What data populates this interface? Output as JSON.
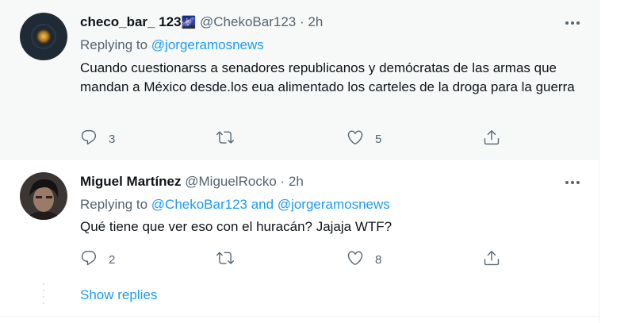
{
  "tweets": [
    {
      "name": "checo_bar_ 123",
      "name_emoji": "🌌",
      "handle": "@ChekoBar123",
      "dot": "·",
      "time": "2h",
      "replying_prefix": "Replying to ",
      "replying_to": "@jorgeramosnews",
      "text": "Cuando cuestionarss a senadores republicanos y demócratas de las armas que mandan a México desde.los eua alimentado los carteles de la droga para la guerra",
      "replies": "3",
      "retweets": "",
      "likes": "5"
    },
    {
      "name": "Miguel Martínez",
      "handle": "@MiguelRocko",
      "dot": "·",
      "time": "2h",
      "replying_prefix": "Replying to ",
      "replying_to_1": "@ChekoBar123",
      "replying_join": " and ",
      "replying_to_2": "@jorgeramosnews",
      "text": "Qué tiene que ver eso con el huracán? Jajaja WTF?",
      "replies": "2",
      "retweets": "",
      "likes": "8"
    }
  ],
  "show_replies": "Show replies",
  "colors": {
    "accent": "#1d9bf0",
    "muted": "#536471",
    "text": "#0f1419",
    "hover_bg": "#f7f9f9"
  },
  "icons": [
    "more-icon",
    "reply-icon",
    "retweet-icon",
    "like-icon",
    "share-icon"
  ]
}
